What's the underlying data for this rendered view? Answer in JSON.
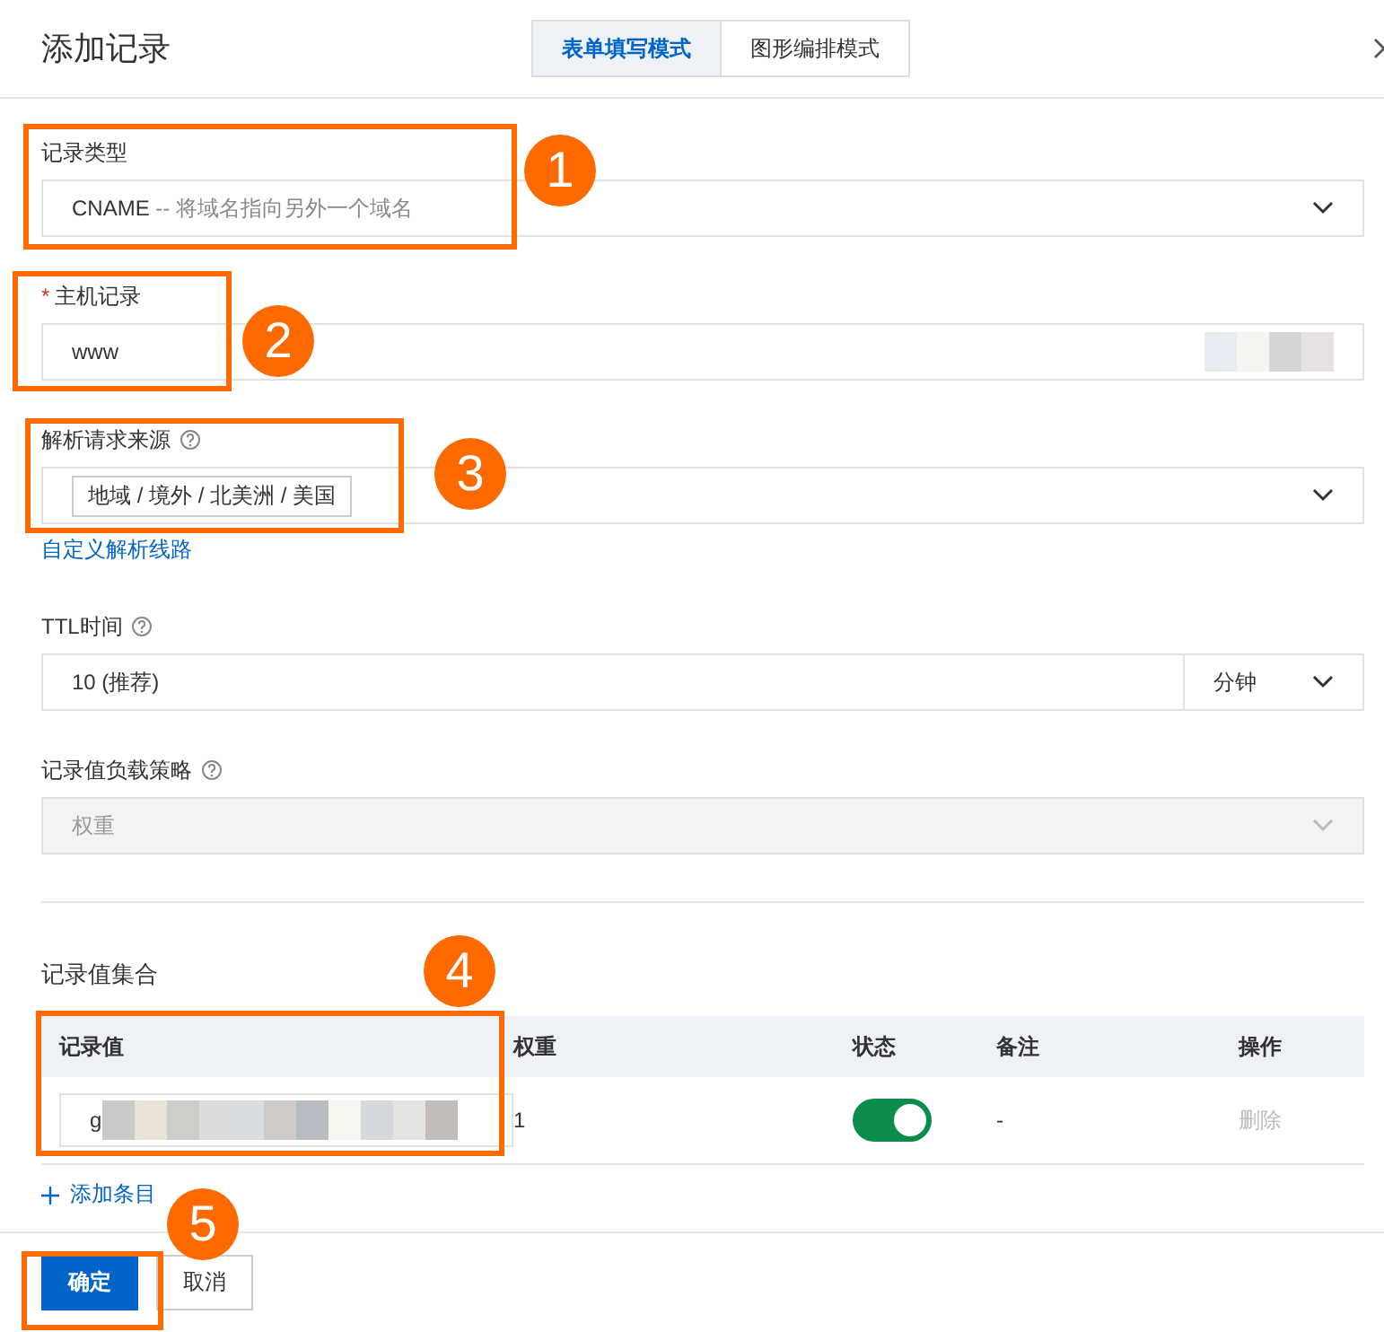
{
  "dialog": {
    "title": "添加记录"
  },
  "mode_tabs": [
    {
      "label": "表单填写模式",
      "selected": true
    },
    {
      "label": "图形编排模式",
      "selected": false
    }
  ],
  "fields": [
    {
      "kind": "select",
      "label": "记录类型",
      "help": false,
      "disabled": false,
      "redacted": false,
      "value": "CNAME",
      "hint": "-- 将域名指向另外一个域名"
    },
    {
      "kind": "input",
      "required_mark": "*",
      "label": "主机记录",
      "help": false,
      "disabled": false,
      "redacted": true,
      "value": "www"
    },
    {
      "kind": "tags",
      "label": "解析请求来源",
      "help": true,
      "disabled": false,
      "redacted": false,
      "tag": "地域 / 境外 / 北美洲 / 美国",
      "link": "自定义解析线路"
    },
    {
      "kind": "unit",
      "label": "TTL时间",
      "help": true,
      "disabled": false,
      "redacted": false,
      "value": "10 (推荐)",
      "unit": "分钟"
    },
    {
      "kind": "select",
      "label": "记录值负载策略",
      "help": true,
      "disabled": true,
      "redacted": false,
      "value": "权重"
    }
  ],
  "record_set": {
    "title": "记录值集合",
    "columns": [
      "记录值",
      "权重",
      "状态",
      "备注",
      "操作"
    ],
    "rows": [
      {
        "value": "g",
        "redacted": true,
        "weight": "1",
        "enabled": true,
        "note": "-",
        "action": "删除",
        "action_disabled": true
      }
    ],
    "add_link": "添加条目"
  },
  "buttons": [
    {
      "kind": "primary",
      "label": "确定"
    },
    {
      "kind": "secondary",
      "label": "取消"
    }
  ],
  "callouts": [
    {
      "number": "1"
    },
    {
      "number": "2"
    },
    {
      "number": "3"
    },
    {
      "number": "4"
    },
    {
      "number": "5"
    }
  ]
}
